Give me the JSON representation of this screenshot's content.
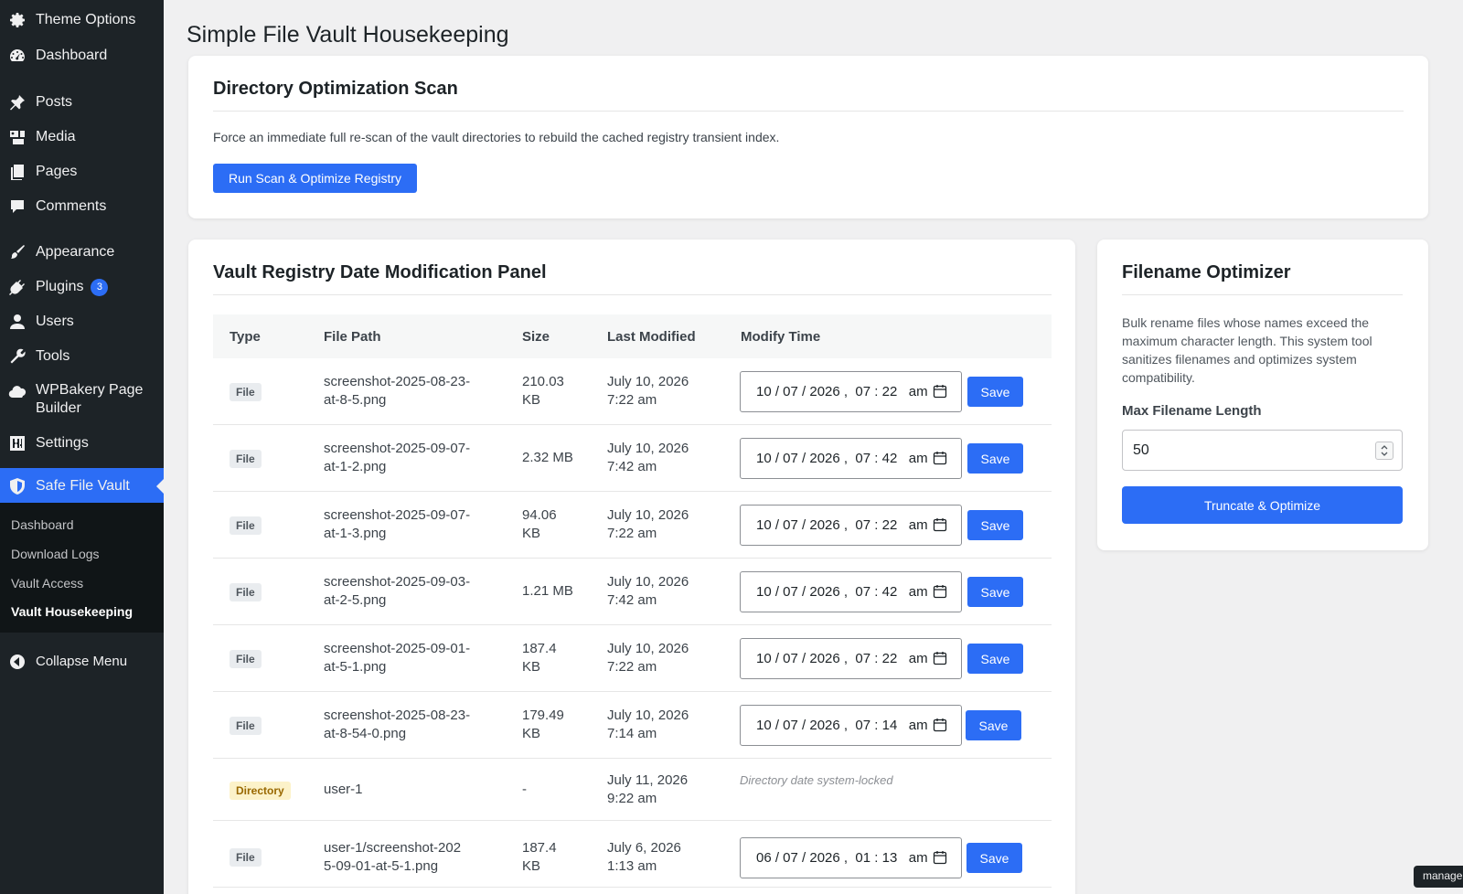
{
  "sidebar": {
    "items": [
      {
        "label": "Theme Options",
        "icon": "gear-icon"
      },
      {
        "label": "Dashboard",
        "icon": "dashboard-icon"
      },
      {
        "label": "Posts",
        "icon": "pin-icon"
      },
      {
        "label": "Media",
        "icon": "media-icon"
      },
      {
        "label": "Pages",
        "icon": "pages-icon"
      },
      {
        "label": "Comments",
        "icon": "comment-icon"
      },
      {
        "label": "Appearance",
        "icon": "brush-icon"
      },
      {
        "label": "Plugins",
        "icon": "plugin-icon",
        "badge": "3"
      },
      {
        "label": "Users",
        "icon": "user-icon"
      },
      {
        "label": "Tools",
        "icon": "wrench-icon"
      },
      {
        "label": "WPBakery Page Builder",
        "label_line1": "WPBakery Page",
        "label_line2": "Builder",
        "icon": "cloud-icon"
      },
      {
        "label": "Settings",
        "icon": "settings-sliders-icon"
      },
      {
        "label": "Safe File Vault",
        "icon": "shield-icon",
        "active": true
      },
      {
        "label": "Collapse Menu",
        "icon": "collapse-icon"
      }
    ],
    "submenu": [
      {
        "label": "Dashboard"
      },
      {
        "label": "Download Logs"
      },
      {
        "label": "Vault Access"
      },
      {
        "label": "Vault Housekeeping",
        "current": true
      }
    ]
  },
  "page": {
    "title": "Simple File Vault Housekeeping"
  },
  "scan": {
    "title": "Directory Optimization Scan",
    "description": "Force an immediate full re-scan of the vault directories to rebuild the cached registry transient index.",
    "button_label": "Run Scan & Optimize Registry"
  },
  "registry": {
    "title": "Vault Registry Date Modification Panel",
    "columns": [
      "Type",
      "File Path",
      "Size",
      "Last Modified",
      "Modify Time"
    ],
    "save_label": "Save",
    "rows": [
      {
        "type": "File",
        "path1": "screenshot-2025-08-23-",
        "path2": "at-8-5.png",
        "size1": "210.03",
        "size2": "KB",
        "mod1": "July 10, 2026",
        "mod2": "7:22 am",
        "dt": "10 / 07 / 2026 ,  07 : 22   am"
      },
      {
        "type": "File",
        "path1": "screenshot-2025-09-07-",
        "path2": "at-1-2.png",
        "size1": "2.32 MB",
        "size2": "",
        "mod1": "July 10, 2026",
        "mod2": "7:42 am",
        "dt": "10 / 07 / 2026 ,  07 : 42   am"
      },
      {
        "type": "File",
        "path1": "screenshot-2025-09-07-",
        "path2": "at-1-3.png",
        "size1": "94.06",
        "size2": "KB",
        "mod1": "July 10, 2026",
        "mod2": "7:22 am",
        "dt": "10 / 07 / 2026 ,  07 : 22   am"
      },
      {
        "type": "File",
        "path1": "screenshot-2025-09-03-",
        "path2": "at-2-5.png",
        "size1": "1.21 MB",
        "size2": "",
        "mod1": "July 10, 2026",
        "mod2": "7:42 am",
        "dt": "10 / 07 / 2026 ,  07 : 42   am"
      },
      {
        "type": "File",
        "path1": "screenshot-2025-09-01-",
        "path2": "at-5-1.png",
        "size1": "187.4",
        "size2": "KB",
        "mod1": "July 10, 2026",
        "mod2": "7:22 am",
        "dt": "10 / 07 / 2026 ,  07 : 22   am"
      },
      {
        "type": "File",
        "path1": "screenshot-2025-08-23-",
        "path2": "at-8-54-0.png",
        "size1": "179.49",
        "size2": "KB",
        "mod1": "July 10, 2026",
        "mod2": "7:14 am",
        "dt": "10 / 07 / 2026 ,  07 : 14   am"
      },
      {
        "type": "Directory",
        "path1": "user-1",
        "path2": "",
        "size1": "-",
        "size2": "",
        "mod1": "July 11, 2026",
        "mod2": "9:22 am",
        "locked": "Directory date system-locked"
      },
      {
        "type": "File",
        "path1": "user-1/screenshot-202",
        "path2": "5-09-01-at-5-1.png",
        "size1": "187.4",
        "size2": "KB",
        "mod1": "July 6, 2026",
        "mod2": "1:13 am",
        "dt": "06 / 07 / 2026 ,  01 : 13   am"
      }
    ]
  },
  "optimizer": {
    "title": "Filename Optimizer",
    "description": "Bulk rename files whose names exceed the maximum character length. This system tool sanitizes filenames and optimizes system compatibility.",
    "field_label": "Max Filename Length",
    "field_value": "50",
    "button_label": "Truncate & Optimize"
  },
  "tooltip": "manager"
}
